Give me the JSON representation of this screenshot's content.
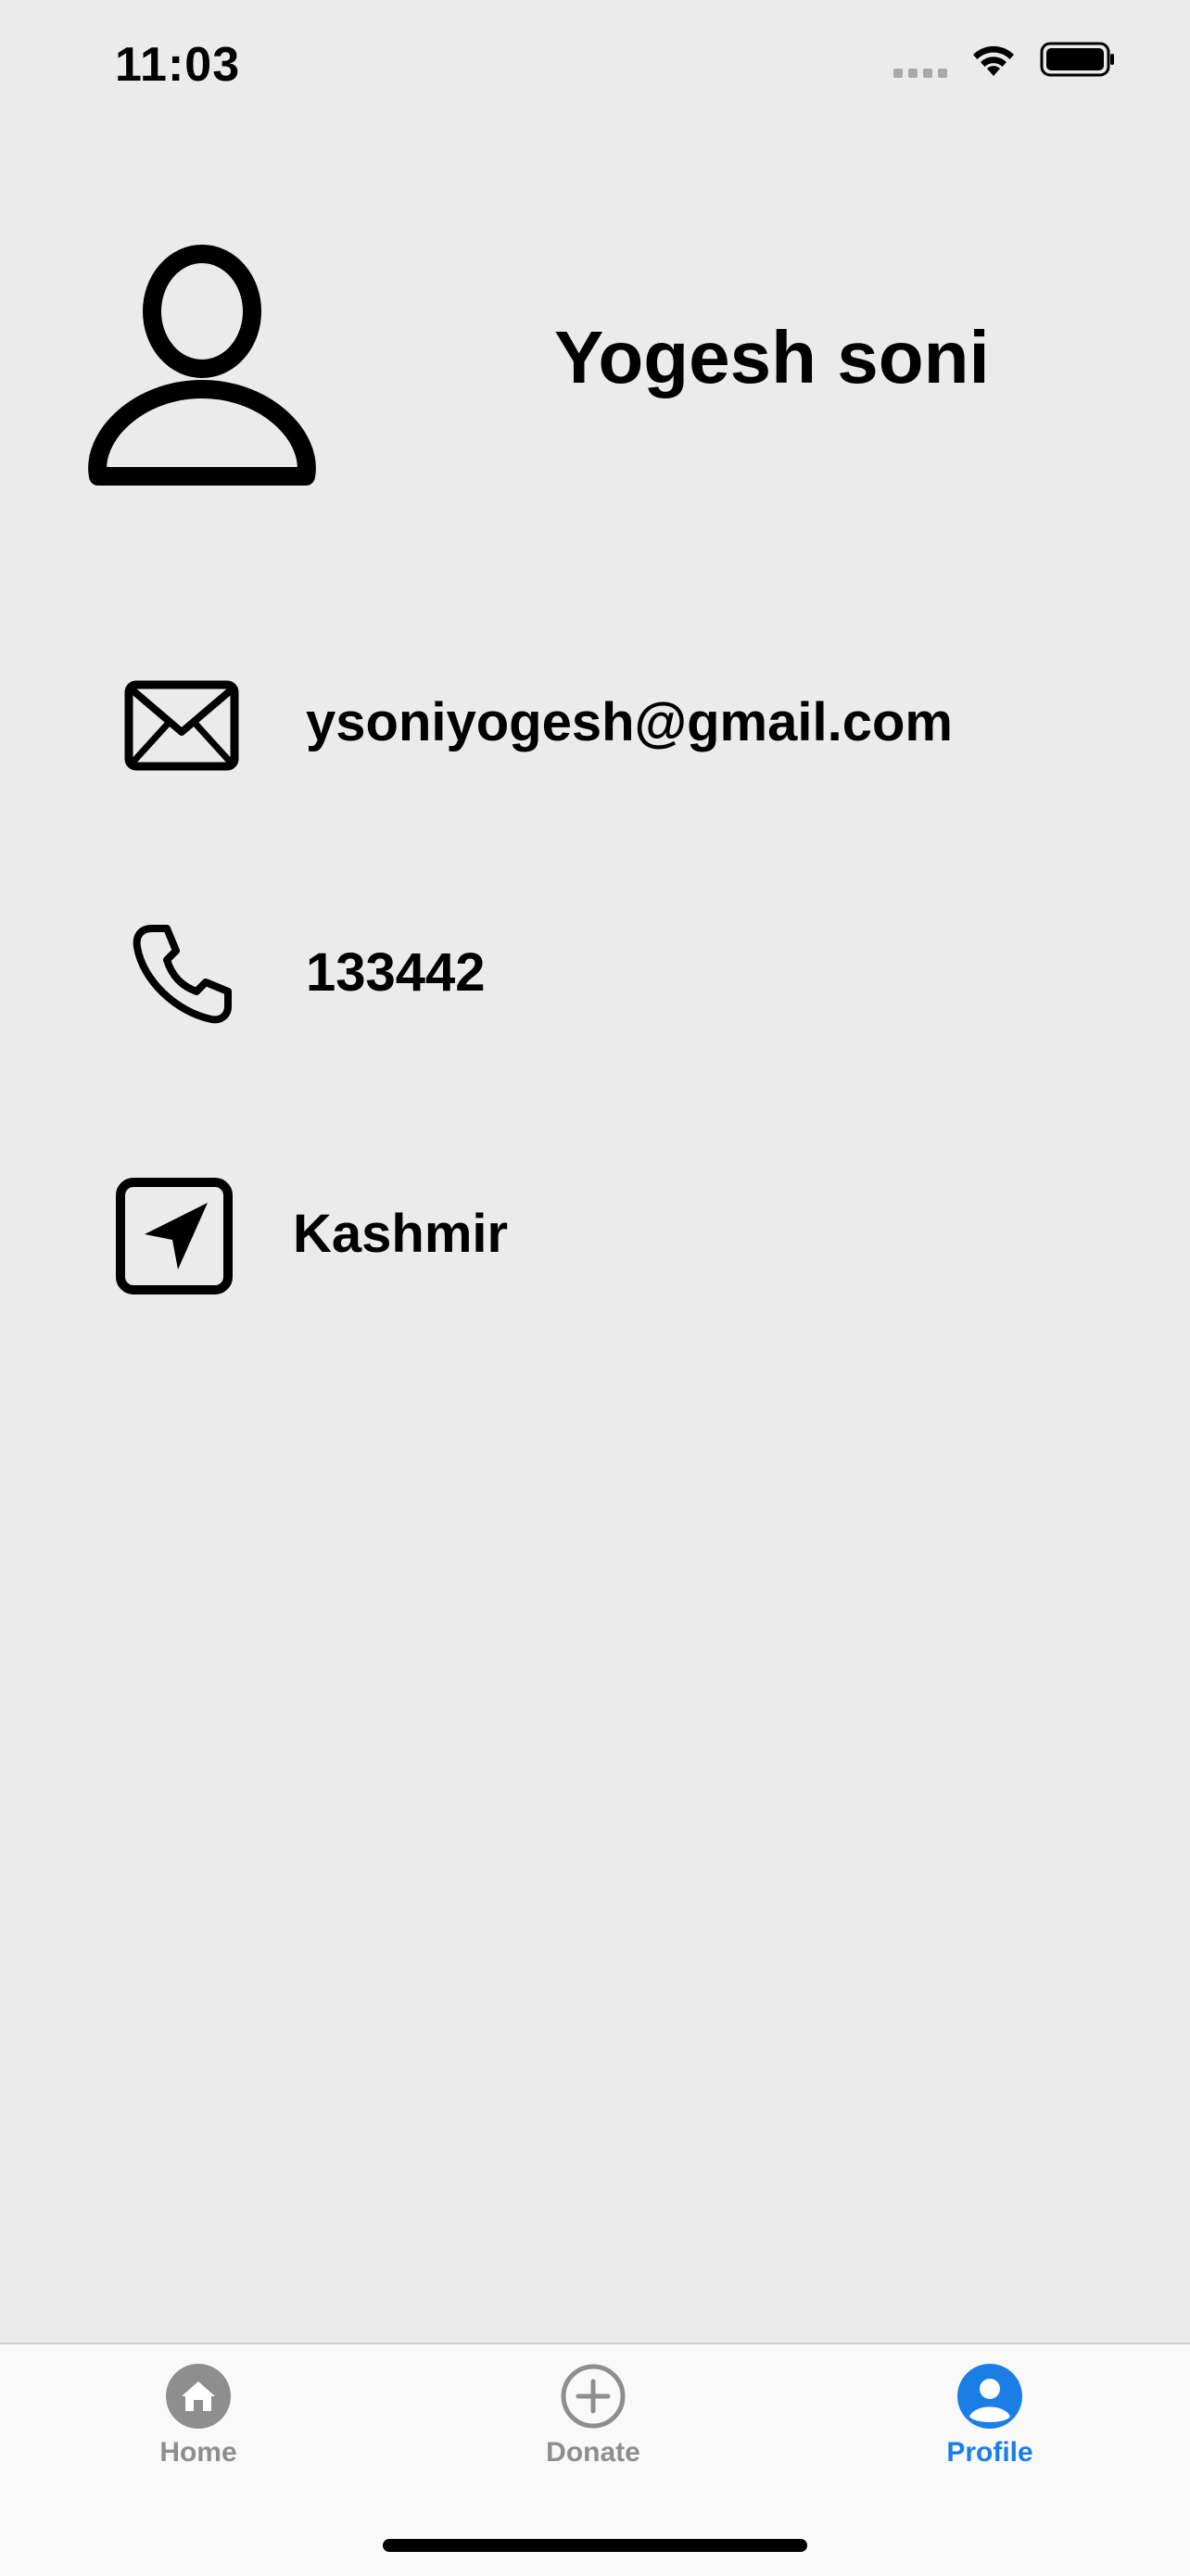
{
  "status_bar": {
    "time": "11:03",
    "icons": [
      "signal-icon",
      "wifi-icon",
      "battery-icon"
    ]
  },
  "profile": {
    "avatar_icon": "person-icon",
    "name": "Yogesh soni"
  },
  "details": {
    "email": {
      "icon": "envelope-icon",
      "value": "ysoniyogesh@gmail.com"
    },
    "phone": {
      "icon": "phone-icon",
      "value": "133442"
    },
    "location": {
      "icon": "location-arrow-icon",
      "value": "Kashmir"
    }
  },
  "tab_bar": {
    "tabs": [
      {
        "label": "Home",
        "icon": "home-icon",
        "active": false
      },
      {
        "label": "Donate",
        "icon": "plus-circle-icon",
        "active": false
      },
      {
        "label": "Profile",
        "icon": "profile-icon",
        "active": true
      }
    ]
  },
  "colors": {
    "background": "#ebebeb",
    "active_tab": "#1a7ee6",
    "inactive_tab": "#8e8e8e",
    "text": "#000000"
  }
}
